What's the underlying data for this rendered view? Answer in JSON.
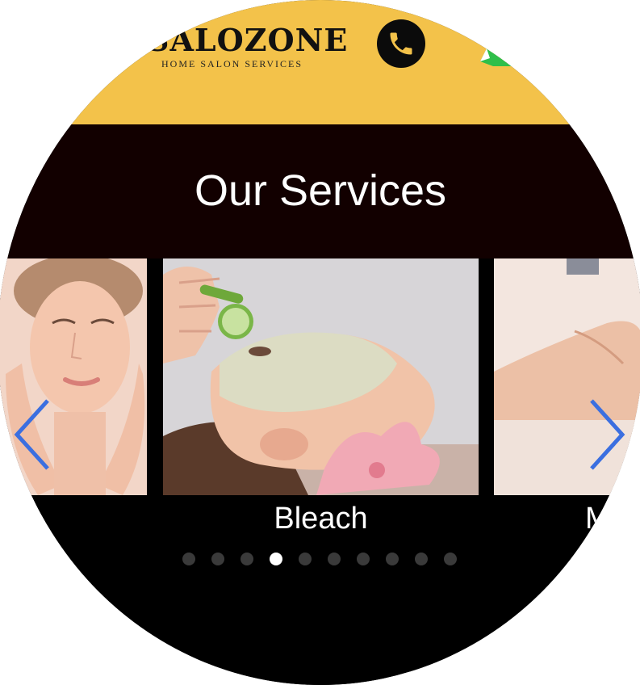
{
  "header": {
    "brand_name": "SALOZONE",
    "tagline": "HOME SALON SERVICES",
    "background_color": "#f3c24a",
    "phone_icon": "phone-icon",
    "whatsapp_icon": "whatsapp-icon"
  },
  "services": {
    "title": "Our Services",
    "background_color": "#120000"
  },
  "carousel": {
    "current_caption": "Bleach",
    "next_caption_partial": "M",
    "prev_arrow_icon": "chevron-left-icon",
    "next_arrow_icon": "chevron-right-icon",
    "arrow_color": "#3b6fe0",
    "dot_count": 10,
    "active_dot_index": 3,
    "slides": [
      {
        "name": "woman-face-hands-photo"
      },
      {
        "name": "facial-mask-cucumber-photo"
      },
      {
        "name": "hand-massage-photo"
      }
    ]
  }
}
